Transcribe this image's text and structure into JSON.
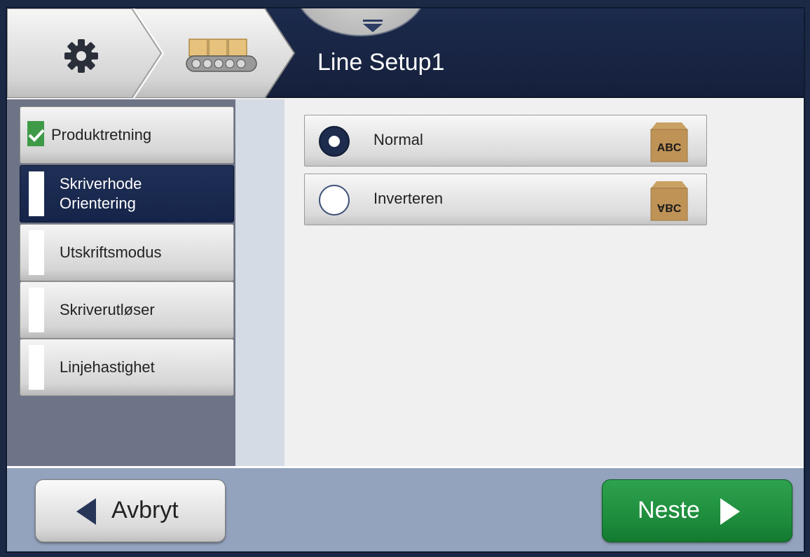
{
  "header": {
    "title": "Line Setup1",
    "breadcrumb": [
      {
        "icon": "gear-icon"
      },
      {
        "icon": "conveyor-icon"
      }
    ],
    "dropdown_icon": "chevron-down-icon"
  },
  "nav": {
    "items": [
      {
        "label": "Produktretning",
        "completed": true,
        "active": false
      },
      {
        "label_line1": "Skriverhode",
        "label_line2": "Orientering",
        "completed": false,
        "active": true
      },
      {
        "label": "Utskriftsmodus",
        "completed": false,
        "active": false
      },
      {
        "label": "Skriverutløser",
        "completed": false,
        "active": false
      },
      {
        "label": "Linjehastighet",
        "completed": false,
        "active": false
      }
    ]
  },
  "options": [
    {
      "label": "Normal",
      "selected": true,
      "icon_text": "ABC"
    },
    {
      "label": "Inverteren",
      "selected": false,
      "icon_text": "ABC"
    }
  ],
  "footer": {
    "cancel_label": "Avbryt",
    "next_label": "Neste"
  },
  "colors": {
    "header_bg": "#1c2a4c",
    "active_nav": "#1f2f55",
    "check_green": "#3f9a48",
    "next_green": "#1b8a3a",
    "footer_bg": "#93a3bd"
  }
}
